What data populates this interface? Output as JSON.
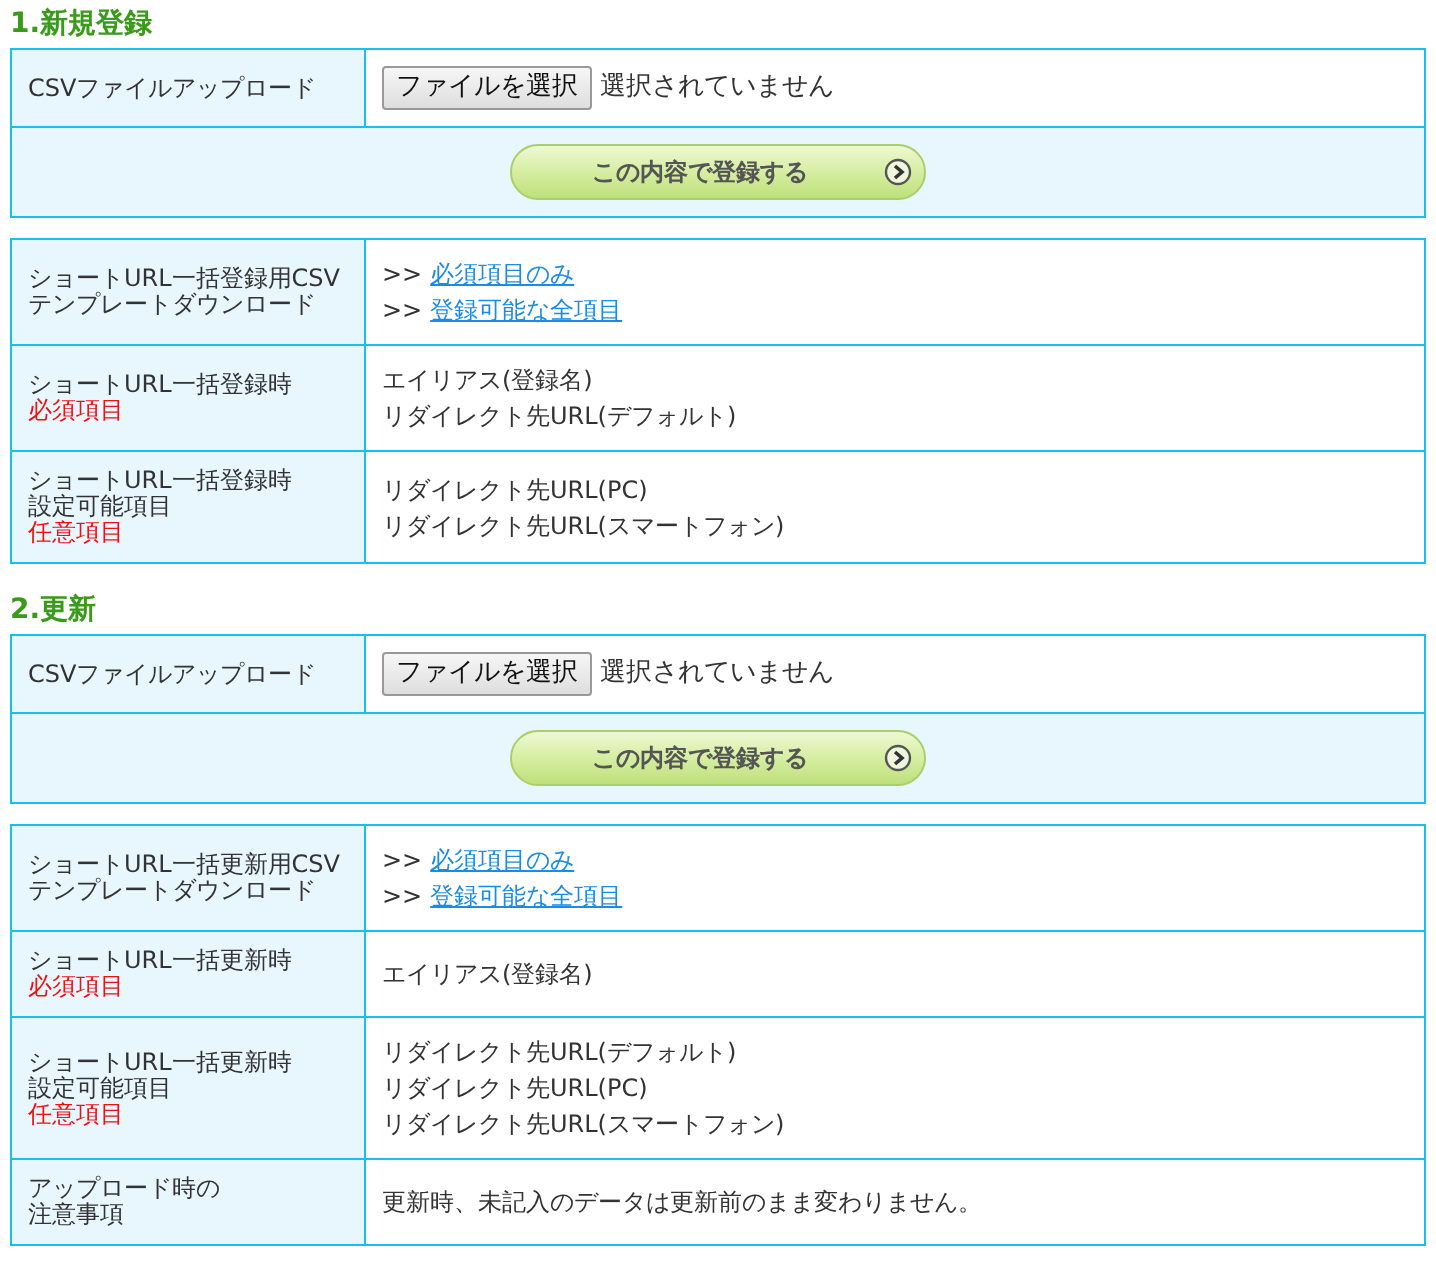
{
  "sections": [
    {
      "heading": "1.新規登録",
      "upload": {
        "label": "CSVファイルアップロード",
        "file_button": "ファイルを選択",
        "file_status": "選択されていません",
        "submit": "この内容で登録する"
      },
      "rows": [
        {
          "label": [
            "ショートURL一括登録用CSV",
            "テンプレートダウンロード"
          ],
          "kind": "links",
          "links": [
            {
              "prefix": ">>",
              "text": "必須項目のみ"
            },
            {
              "prefix": ">>",
              "text": "登録可能な全項目"
            }
          ]
        },
        {
          "label": [
            "ショートURL一括登録時"
          ],
          "red_label": "必須項目",
          "kind": "text",
          "lines": [
            "エイリアス(登録名)",
            "リダイレクト先URL(デフォルト)"
          ]
        },
        {
          "label": [
            "ショートURL一括登録時",
            "設定可能項目"
          ],
          "red_label": "任意項目",
          "kind": "text",
          "lines": [
            "リダイレクト先URL(PC)",
            "リダイレクト先URL(スマートフォン)"
          ]
        }
      ]
    },
    {
      "heading": "2.更新",
      "upload": {
        "label": "CSVファイルアップロード",
        "file_button": "ファイルを選択",
        "file_status": "選択されていません",
        "submit": "この内容で登録する"
      },
      "rows": [
        {
          "label": [
            "ショートURL一括更新用CSV",
            "テンプレートダウンロード"
          ],
          "kind": "links",
          "links": [
            {
              "prefix": ">>",
              "text": "必須項目のみ"
            },
            {
              "prefix": ">>",
              "text": "登録可能な全項目"
            }
          ]
        },
        {
          "label": [
            "ショートURL一括更新時"
          ],
          "red_label": "必須項目",
          "kind": "text",
          "lines": [
            "エイリアス(登録名)"
          ]
        },
        {
          "label": [
            "ショートURL一括更新時",
            "設定可能項目"
          ],
          "red_label": "任意項目",
          "kind": "text",
          "lines": [
            "リダイレクト先URL(デフォルト)",
            "リダイレクト先URL(PC)",
            "リダイレクト先URL(スマートフォン)"
          ]
        },
        {
          "label": [
            "アップロード時の",
            "注意事項"
          ],
          "kind": "text",
          "lines": [
            "更新時、未記入のデータは更新前のまま変わりません。"
          ]
        }
      ]
    }
  ]
}
